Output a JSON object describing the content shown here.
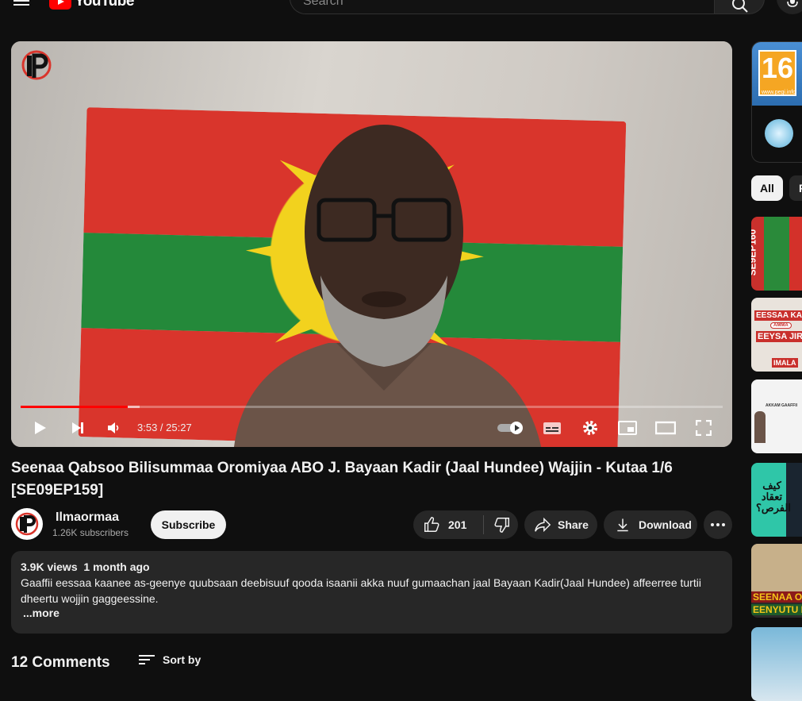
{
  "header": {
    "logo_text": "YouTube",
    "search_placeholder": "Search"
  },
  "player": {
    "current_time": "3:53",
    "duration": "25:27",
    "time_display": "3:53 / 25:27",
    "progress_fraction": 0.153,
    "buffered_fraction": 0.17
  },
  "video": {
    "title": "Seenaa Qabsoo Bilisummaa Oromiyaa ABO J. Bayaan Kadir (Jaal Hundee) Wajjin - Kutaa 1/6 [SE09EP159]"
  },
  "channel": {
    "name": "Ilmaormaa",
    "subscribers": "1.26K subscribers",
    "subscribe_label": "Subscribe"
  },
  "actions": {
    "like_count": "201",
    "share_label": "Share",
    "download_label": "Download"
  },
  "description": {
    "views": "3.9K views",
    "date": "1 month ago",
    "text": "Gaaffii eessaa kaanee as-geenye quubsaan deebisuuf qooda isaanii akka nuuf gumaachan jaal Bayaan Kadir(Jaal Hundee) affeerree turtii dheertu wojjin gaggeessine.",
    "more_label": "...more"
  },
  "comments": {
    "title": "12 Comments",
    "sort_label": "Sort by"
  },
  "sidebar": {
    "ad": {
      "rating": "16",
      "url": "www.pegi.info"
    },
    "chips": [
      "All",
      "F"
    ],
    "thumbs": [
      {
        "text": "SE9EP160"
      },
      {
        "text": "EESSAA KA'E",
        "text2": "AMMA",
        "text3": "EEYSA JIRA",
        "text4": "IMALA"
      },
      {
        "text": "AKKAM GAAFFII"
      },
      {
        "text": "كيف تعقاد الفرص؟"
      },
      {
        "text": "SEENAA OR",
        "text2": "EENYUTU B"
      },
      {
        "text": ""
      }
    ]
  },
  "colors": {
    "background": "#0f0f0f",
    "accent_red": "#ff0000",
    "surface": "#272727"
  }
}
